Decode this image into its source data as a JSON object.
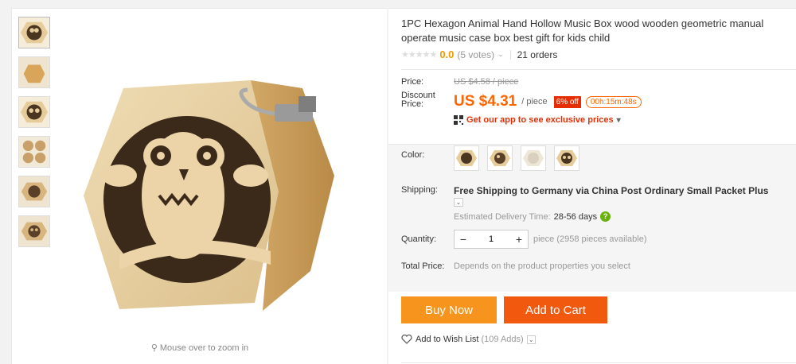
{
  "product": {
    "title": "1PC Hexagon Animal Hand Hollow Music Box wood wooden geometric manual operate music case box best gift for kids child",
    "rating": {
      "stars": "★★★★★",
      "value": "0.0",
      "votes": "(5 votes)",
      "orders": "21 orders"
    }
  },
  "gallery": {
    "zoom_hint": "Mouse over to zoom in",
    "thumbnails": [
      "owl-hexagon",
      "plain-box",
      "owl-hexagon",
      "multi-boxes",
      "owl-hexagon",
      "owl-hexagon"
    ]
  },
  "price": {
    "label": "Price:",
    "original": "US $4.58 / piece",
    "discount_label": "Discount Price:",
    "current": "US $4.31",
    "unit": "/ piece",
    "discount_badge": "6% off",
    "timer": "00h:15m:48s",
    "app_promo": "Get our app to see exclusive prices",
    "app_promo_caret": "▾"
  },
  "options": {
    "color_label": "Color:",
    "shipping_label": "Shipping:",
    "shipping_text": "Free Shipping to Germany via China Post Ordinary Small Packet Plus",
    "shipping_caret": "⌄",
    "delivery_label": "Estimated Delivery Time:",
    "delivery_days": "28-56 days",
    "delivery_help": "?",
    "quantity_label": "Quantity:",
    "quantity_value": "1",
    "qty_minus": "−",
    "qty_plus": "+",
    "quantity_note": "piece (2958 pieces available)",
    "total_label": "Total Price:",
    "total_note": "Depends on the product properties you select"
  },
  "actions": {
    "buy_now": "Buy Now",
    "add_to_cart": "Add to Cart",
    "wish_label": "Add to Wish List",
    "wish_count": "(109 Adds)",
    "wish_caret": "⌄"
  },
  "colors": {
    "accent": "#ff6600",
    "buy": "#f7941d",
    "cart": "#f1590f",
    "badge": "#e62e04"
  }
}
